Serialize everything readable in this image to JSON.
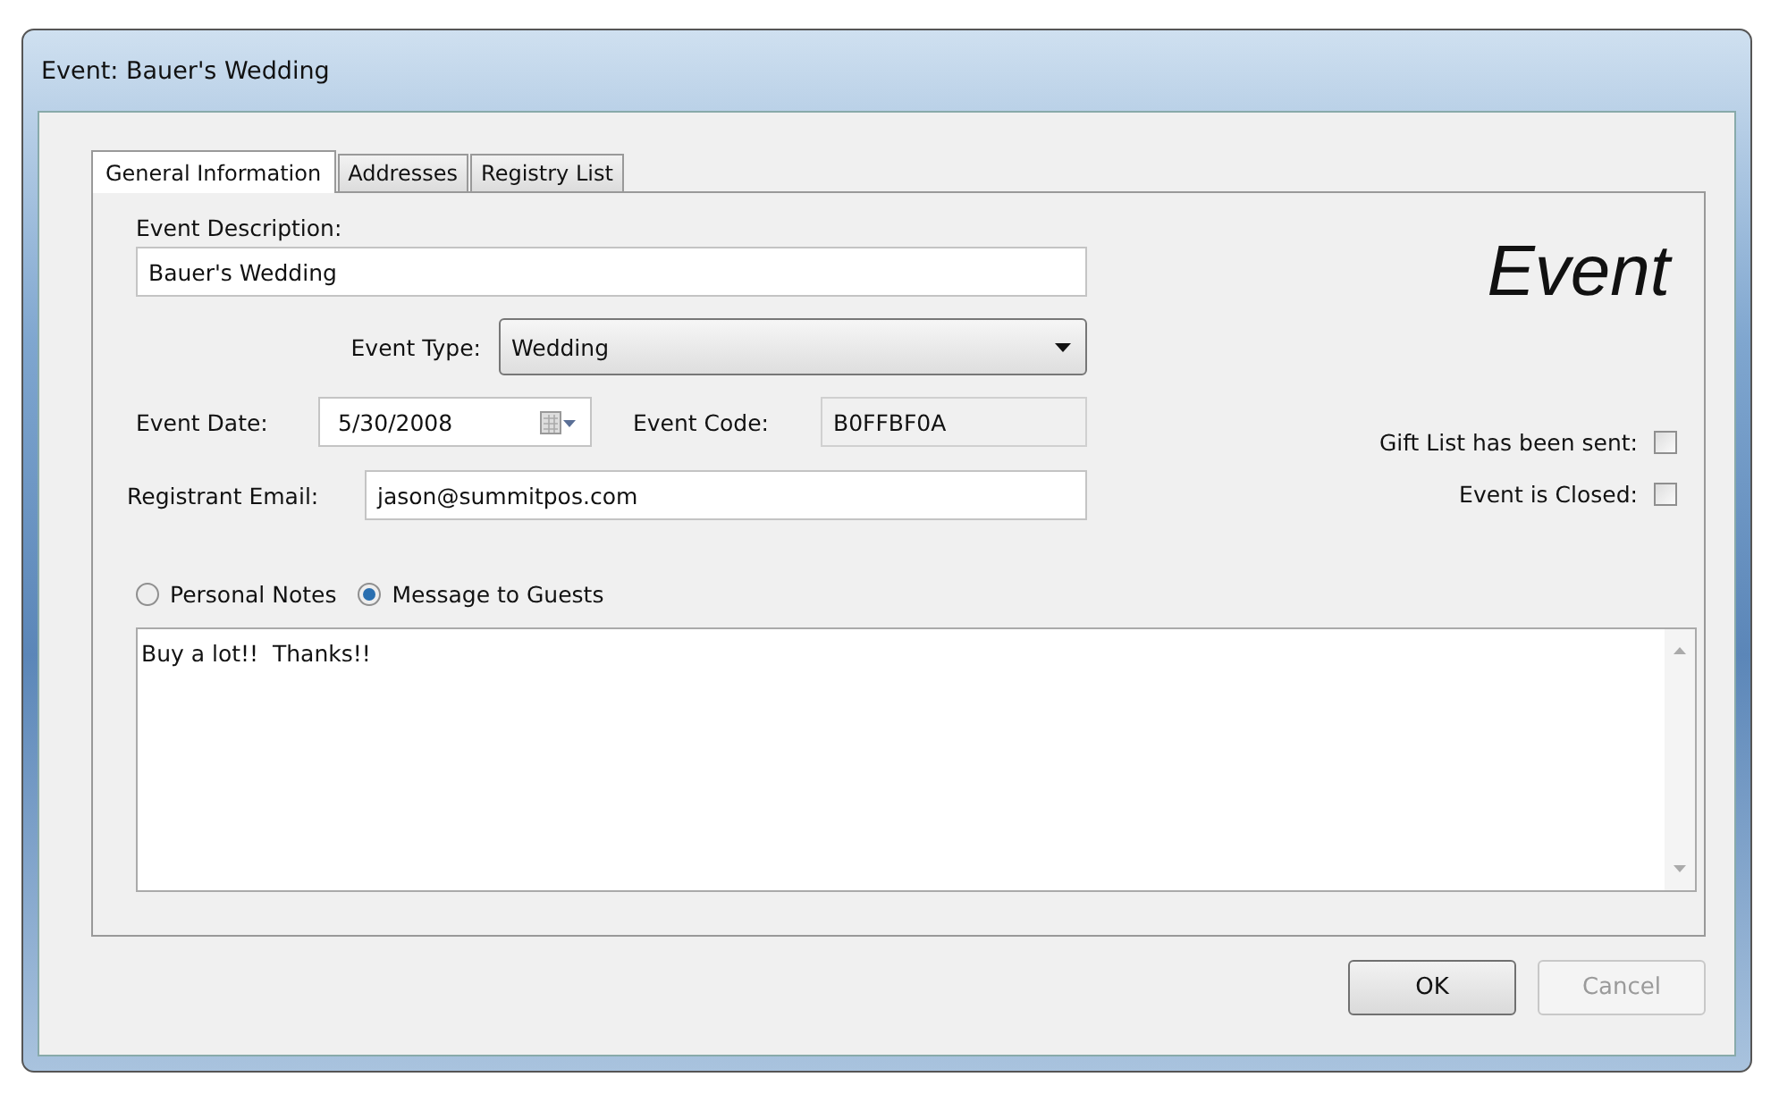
{
  "window": {
    "title": "Event: Bauer's Wedding"
  },
  "tabs": [
    {
      "label": "General Information",
      "selected": true
    },
    {
      "label": "Addresses",
      "selected": false
    },
    {
      "label": "Registry List",
      "selected": false
    }
  ],
  "heading": "Event",
  "event_description": {
    "label": "Event Description:",
    "value": "Bauer's Wedding"
  },
  "event_type": {
    "label": "Event Type:",
    "value": "Wedding"
  },
  "event_date": {
    "label": "Event Date:",
    "value": "5/30/2008"
  },
  "event_code": {
    "label": "Event Code:",
    "value": "B0FFBF0A"
  },
  "registrant_email": {
    "label": "Registrant Email:",
    "value": "jason@summitpos.com"
  },
  "checkboxes": [
    {
      "label": "Gift List has been sent:",
      "checked": false
    },
    {
      "label": "Event is Closed:",
      "checked": false
    }
  ],
  "note_options": [
    {
      "label": "Personal Notes",
      "selected": false
    },
    {
      "label": "Message to Guests",
      "selected": true
    }
  ],
  "message": "Buy a lot!!  Thanks!!",
  "buttons": [
    {
      "label": "OK",
      "disabled": false
    },
    {
      "label": "Cancel",
      "disabled": true
    }
  ]
}
